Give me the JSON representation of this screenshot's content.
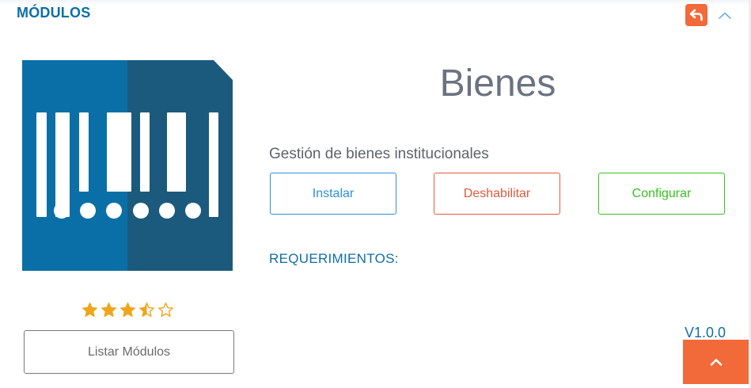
{
  "card": {
    "title": "MÓDULOS"
  },
  "icons": {
    "back": "undo-arrow-icon",
    "collapse": "chevron-up-icon",
    "scroll_top": "chevron-up-icon",
    "logo": "barcode-icon"
  },
  "module": {
    "name": "Bienes",
    "description": "Gestión de bienes institucionales",
    "requirements_label": "REQUERIMIENTOS:",
    "version": "V1.0.0",
    "rating": 3.5,
    "rating_max": 5
  },
  "actions": {
    "install": "Instalar",
    "disable": "Deshabilitar",
    "configure": "Configurar",
    "list_modules": "Listar Módulos"
  },
  "colors": {
    "brand_blue": "#0e6ea8",
    "accent_orange": "#f26a3a",
    "install_blue": "#2f8fd6",
    "disable_red": "#e35a3c",
    "config_green": "#34c31f",
    "star_gold": "#f0a51a",
    "logo_left": "#0a6fa6",
    "logo_right": "#1b5a7c"
  }
}
